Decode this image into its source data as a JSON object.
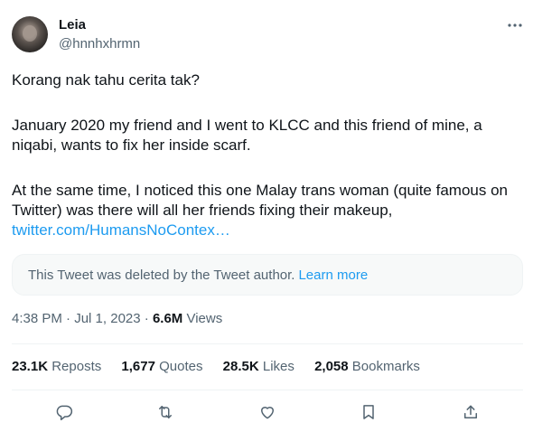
{
  "author": {
    "name": "Leia",
    "handle": "@hnnhxhrmn"
  },
  "tweet": {
    "paragraph1": "Korang nak tahu cerita tak?",
    "paragraph2_line1": "January 2020 my friend and I went to KLCC and this friend of mine, a",
    "paragraph2_line2": "niqabi, wants to fix her inside scarf.",
    "paragraph3_line1": "At the same time, I noticed this one Malay trans woman (quite famous on",
    "paragraph3_line2": "Twitter) was there will all her friends fixing their makeup,",
    "link_text": "twitter.com/HumansNoContex…"
  },
  "quoted": {
    "deleted_text": "This Tweet was deleted by the Tweet author.",
    "learn_more": "Learn more"
  },
  "meta": {
    "time": "4:38 PM",
    "separator": "·",
    "date": "Jul 1, 2023",
    "views_count": "6.6M",
    "views_label": "Views"
  },
  "stats": {
    "reposts_count": "23.1K",
    "reposts_label": "Reposts",
    "quotes_count": "1,677",
    "quotes_label": "Quotes",
    "likes_count": "28.5K",
    "likes_label": "Likes",
    "bookmarks_count": "2,058",
    "bookmarks_label": "Bookmarks"
  },
  "icons": {
    "more": "more-horizontal-icon",
    "reply": "reply-icon",
    "repost": "repost-icon",
    "like": "like-icon",
    "bookmark": "bookmark-icon",
    "share": "share-icon"
  },
  "colors": {
    "text_primary": "#0f1419",
    "text_secondary": "#536471",
    "link": "#1d9bf0",
    "divider": "#eff3f4",
    "quoted_bg": "#f7f9f9"
  }
}
